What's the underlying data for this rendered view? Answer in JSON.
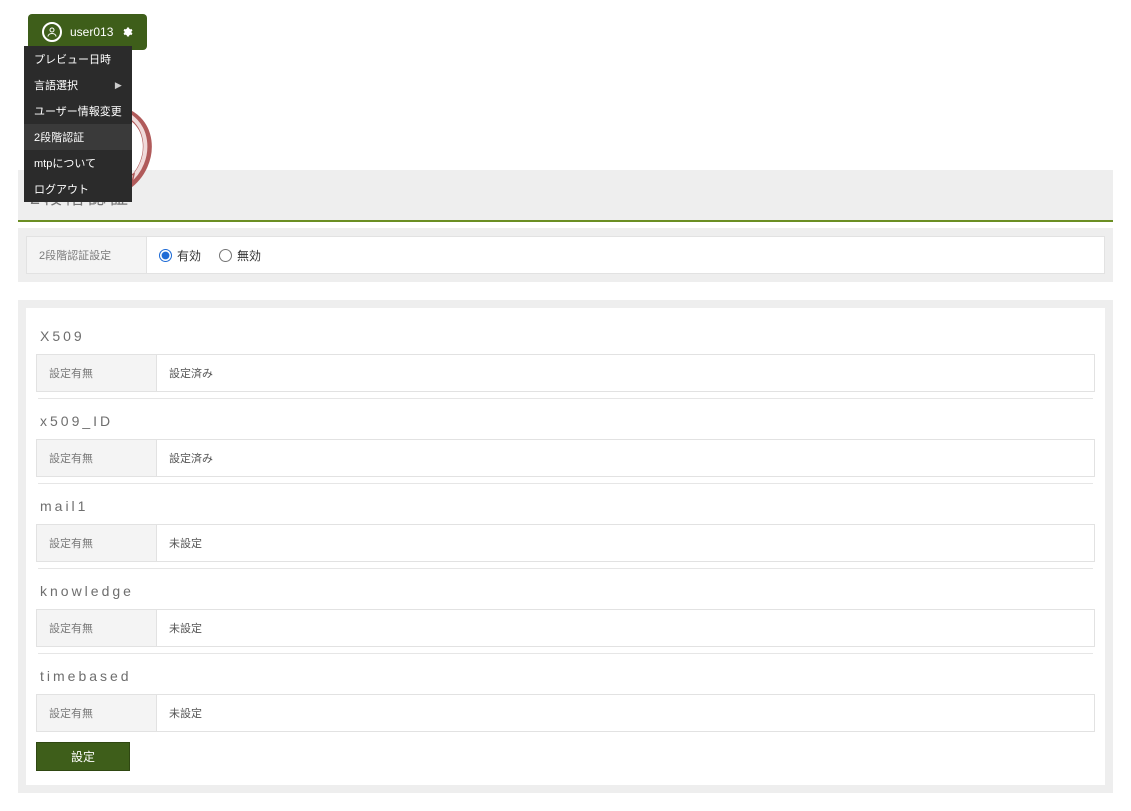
{
  "user": {
    "name": "user013"
  },
  "dropdown": {
    "items": [
      {
        "label": "プレビュー日時",
        "submenu": false
      },
      {
        "label": "言語選択",
        "submenu": true
      },
      {
        "label": "ユーザー情報変更",
        "submenu": false
      },
      {
        "label": "2段階認証",
        "submenu": false,
        "highlight": true
      },
      {
        "label": "mtpについて",
        "submenu": false
      },
      {
        "label": "ログアウト",
        "submenu": false
      }
    ]
  },
  "page": {
    "title": "2段階認証"
  },
  "settings_panel": {
    "label": "2段階認証設定",
    "options": {
      "enabled": "有効",
      "disabled": "無効"
    },
    "selected": "enabled"
  },
  "sections": [
    {
      "title": "X509",
      "row_label": "設定有無",
      "row_value": "設定済み"
    },
    {
      "title": "x509_ID",
      "row_label": "設定有無",
      "row_value": "設定済み"
    },
    {
      "title": "mail1",
      "row_label": "設定有無",
      "row_value": "未設定"
    },
    {
      "title": "knowledge",
      "row_label": "設定有無",
      "row_value": "未設定"
    },
    {
      "title": "timebased",
      "row_label": "設定有無",
      "row_value": "未設定"
    }
  ],
  "submit_label": "設定"
}
